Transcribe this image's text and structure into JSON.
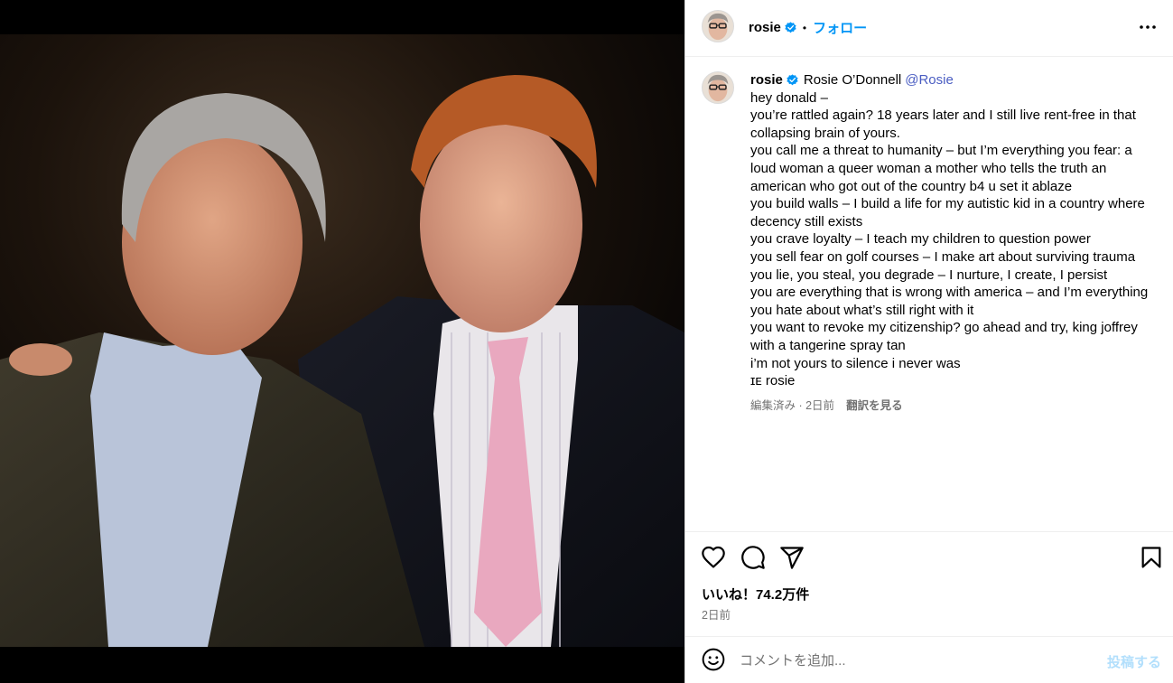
{
  "header": {
    "username": "rosie",
    "separator": "•",
    "follow_label": "フォロー",
    "more_icon": "more-horizontal-icon"
  },
  "caption": {
    "username": "rosie",
    "full_name": "Rosie O’Donnell",
    "handle": "@Rosie",
    "lines": [
      "hey donald –",
      "you’re rattled again?  18 years later and I still live rent-free in that collapsing brain of yours.",
      "you call me a threat to humanity – but I’m everything you fear: a loud woman a queer woman a mother who tells the truth an american who got out of the country b4 u set it ablaze",
      "you build walls – I build a life for my autistic kid in a country where decency still exists",
      "you crave loyalty – I teach my children to question power",
      "you sell fear on golf courses – I make art about surviving trauma",
      "you lie, you steal, you degrade – I nurture, I create, I persist",
      "you are everything that is wrong with america – and I’m everything you hate about what’s still right with it",
      "you want to revoke my citizenship? go ahead and try, king joffrey with a tangerine spray tan",
      "i’m not yours to silence i never was",
      "ɪᴇ rosie"
    ],
    "meta": "編集済み · 2日前",
    "translate_label": "翻訳を見る"
  },
  "actions": {
    "like_icon": "heart-icon",
    "comment_icon": "comment-icon",
    "share_icon": "send-icon",
    "save_icon": "bookmark-icon"
  },
  "likes": "いいね！74.2万件",
  "time_ago": "2日前",
  "comment": {
    "emoji_icon": "emoji-icon",
    "placeholder": "コメントを追加...",
    "post_label": "投稿する"
  },
  "colors": {
    "accent": "#0095f6",
    "verified": "#0095f6",
    "handle": "#4a5dc2",
    "muted": "#737373",
    "post_disabled": "#b2dffc"
  }
}
